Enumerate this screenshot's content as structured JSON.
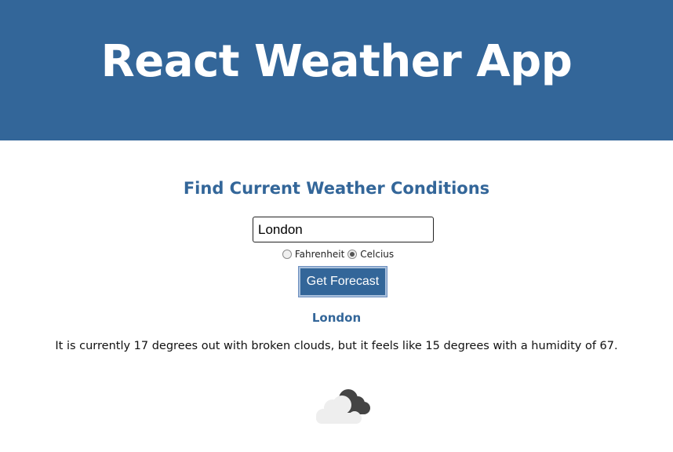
{
  "header": {
    "title": "React Weather App"
  },
  "form": {
    "heading": "Find Current Weather Conditions",
    "city_value": "London",
    "units": {
      "options": [
        "Fahrenheit",
        "Celcius"
      ],
      "selected": "Celcius"
    },
    "submit_label": "Get Forecast"
  },
  "result": {
    "city": "London",
    "description": "It is currently 17 degrees out with broken clouds, but it feels like 15 degrees with a humidity of 67.",
    "icon": "broken-clouds-icon"
  },
  "colors": {
    "brand": "#336699",
    "background": "#ffffff"
  }
}
